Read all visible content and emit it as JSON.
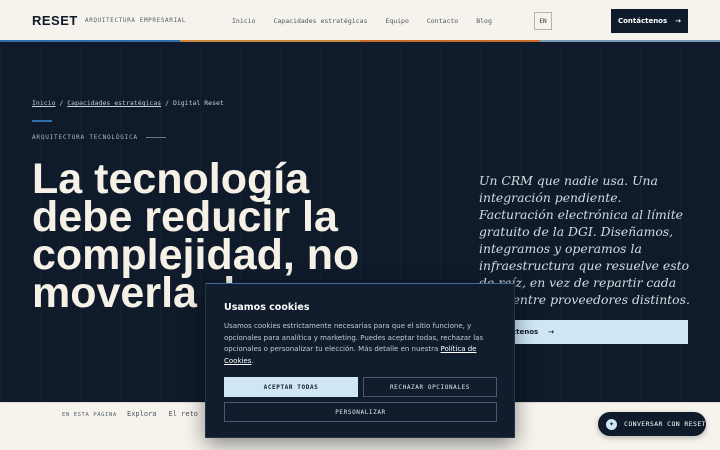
{
  "header": {
    "logo": "RESET",
    "tagline": "ARQUITECTURA EMPRESARIAL",
    "nav": [
      "Inicio",
      "Capacidades estratégicas",
      "Equipo",
      "Contacto",
      "Blog"
    ],
    "lang": "EN",
    "contact_label": "Contáctenos",
    "contact_arrow": "→"
  },
  "stripe_colors": [
    "#2f6fad",
    "#c9853f",
    "#c86b2a",
    "#7a9cb8"
  ],
  "breadcrumb": {
    "home": "Inicio",
    "sep": "/",
    "section": "Capacidades estratégicas",
    "current": "Digital Reset"
  },
  "hero": {
    "eyebrow": "ARQUITECTURA TECNOLÓGICA",
    "headline_lines": [
      "La tecnología",
      "debe reducir la",
      "complejidad, no",
      "moverla d"
    ],
    "lead": "Un CRM que nadie usa. Una integración pendiente. Facturación electrónica al límite gratuito de la DGI. Diseñamos, integramos y operamos la infraestructura que resuelve esto de raíz, en vez de repartir cada capa entre proveedores distintos.",
    "cta_label": "Contáctenos",
    "cta_arrow": "→"
  },
  "onpage": {
    "label": "EN ESTA PÁGINA",
    "links": [
      "Explora",
      "El reto"
    ]
  },
  "chat": {
    "label": "CONVERSAR CON RESET"
  },
  "cookie": {
    "title": "Usamos cookies",
    "body": "Usamos cookies estrictamente necesarias para que el sitio funcione, y opcionales para analítica y marketing. Puedes aceptar todas, rechazar las opcionales o personalizar tu elección. Más detalle en nuestra ",
    "policy_link": "Política de Cookies",
    "accept": "ACEPTAR TODAS",
    "reject": "RECHAZAR OPCIONALES",
    "customize": "PERSONALIZAR"
  }
}
